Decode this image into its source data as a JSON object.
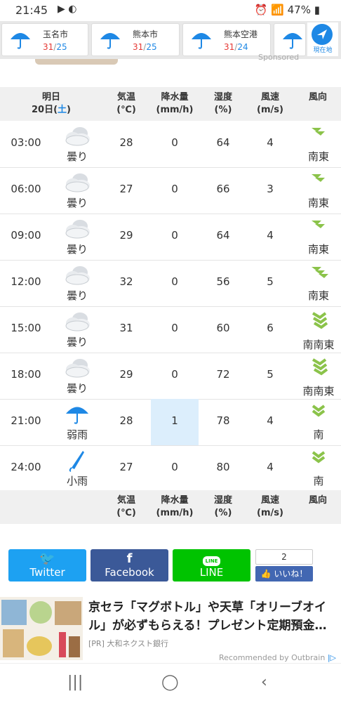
{
  "status": {
    "time": "21:45",
    "battery": "47%"
  },
  "cities": [
    {
      "name": "玉名市",
      "hi": "31",
      "lo": "25"
    },
    {
      "name": "熊本市",
      "hi": "31",
      "lo": "25"
    },
    {
      "name": "熊本空港",
      "hi": "31",
      "lo": "24"
    }
  ],
  "location_button": "現在地",
  "sponsored": "Sponsored",
  "header": {
    "day": "明日",
    "date": "20日(",
    "weekday": "土",
    "date_close": ")",
    "temp": "気温",
    "temp_unit": "(℃)",
    "rain": "降水量",
    "rain_unit": "(mm/h)",
    "humidity": "湿度",
    "humidity_unit": "(%)",
    "wind": "風速",
    "wind_unit": "(m/s)",
    "direction": "風向"
  },
  "rows": [
    {
      "time": "03:00",
      "weather": "曇り",
      "icon": "cloud-icon",
      "temp": "28",
      "rain": "0",
      "humidity": "64",
      "wind": "4",
      "dir": "南東"
    },
    {
      "time": "06:00",
      "weather": "曇り",
      "icon": "cloud-icon",
      "temp": "27",
      "rain": "0",
      "humidity": "66",
      "wind": "3",
      "dir": "南東"
    },
    {
      "time": "09:00",
      "weather": "曇り",
      "icon": "cloud-icon",
      "temp": "29",
      "rain": "0",
      "humidity": "64",
      "wind": "4",
      "dir": "南東"
    },
    {
      "time": "12:00",
      "weather": "曇り",
      "icon": "cloud-icon",
      "temp": "32",
      "rain": "0",
      "humidity": "56",
      "wind": "5",
      "dir": "南東"
    },
    {
      "time": "15:00",
      "weather": "曇り",
      "icon": "cloud-icon",
      "temp": "31",
      "rain": "0",
      "humidity": "60",
      "wind": "6",
      "dir": "南南東"
    },
    {
      "time": "18:00",
      "weather": "曇り",
      "icon": "cloud-icon",
      "temp": "29",
      "rain": "0",
      "humidity": "72",
      "wind": "5",
      "dir": "南南東"
    },
    {
      "time": "21:00",
      "weather": "弱雨",
      "icon": "umbrella-icon",
      "temp": "28",
      "rain": "1",
      "humidity": "78",
      "wind": "4",
      "dir": "南"
    },
    {
      "time": "24:00",
      "weather": "小雨",
      "icon": "closed-umbrella-icon",
      "temp": "27",
      "rain": "0",
      "humidity": "80",
      "wind": "4",
      "dir": "南"
    }
  ],
  "share": {
    "twitter": "Twitter",
    "facebook": "Facebook",
    "line": "LINE",
    "like_count": "2",
    "like_label": "いいね！"
  },
  "ad": {
    "title": "京セラ「マグボトル」や天草「オリーブオイル」が必ずもらえる！プレゼント定期預金…",
    "source": "[PR] 大和ネクスト銀行",
    "recommended": "Recommended by Outbrain"
  },
  "colors": {
    "hi": "#e53935",
    "lo": "#1e88e5",
    "arrow": "#8bc34a",
    "twitter": "#1da1f2",
    "facebook": "#3b5998",
    "line": "#00c300"
  }
}
